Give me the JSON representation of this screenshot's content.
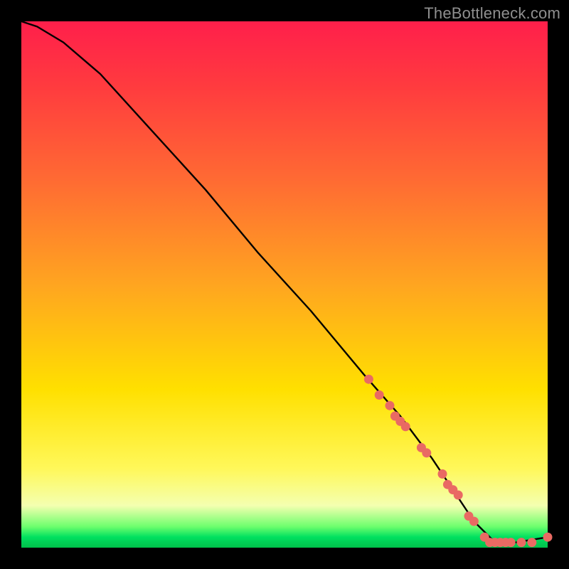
{
  "watermark": "TheBottleneck.com",
  "chart_data": {
    "type": "line",
    "title": "",
    "xlabel": "",
    "ylabel": "",
    "xlim": [
      0,
      100
    ],
    "ylim": [
      0,
      100
    ],
    "series": [
      {
        "name": "curve",
        "x": [
          0,
          3,
          8,
          15,
          25,
          35,
          45,
          55,
          65,
          72,
          78,
          82,
          86,
          90,
          94,
          100
        ],
        "y": [
          100,
          99,
          96,
          90,
          79,
          68,
          56,
          45,
          33,
          25,
          17,
          11,
          5,
          1,
          1,
          2
        ]
      }
    ],
    "markers": {
      "name": "highlight-points",
      "color": "#e96a63",
      "x": [
        66,
        68,
        70,
        71,
        72,
        73,
        76,
        77,
        80,
        81,
        82,
        83,
        85,
        86,
        88,
        89,
        90,
        91,
        92,
        93,
        95,
        97,
        100
      ],
      "y": [
        32,
        29,
        27,
        25,
        24,
        23,
        19,
        18,
        14,
        12,
        11,
        10,
        6,
        5,
        2,
        1,
        1,
        1,
        1,
        1,
        1,
        1,
        2
      ]
    }
  }
}
